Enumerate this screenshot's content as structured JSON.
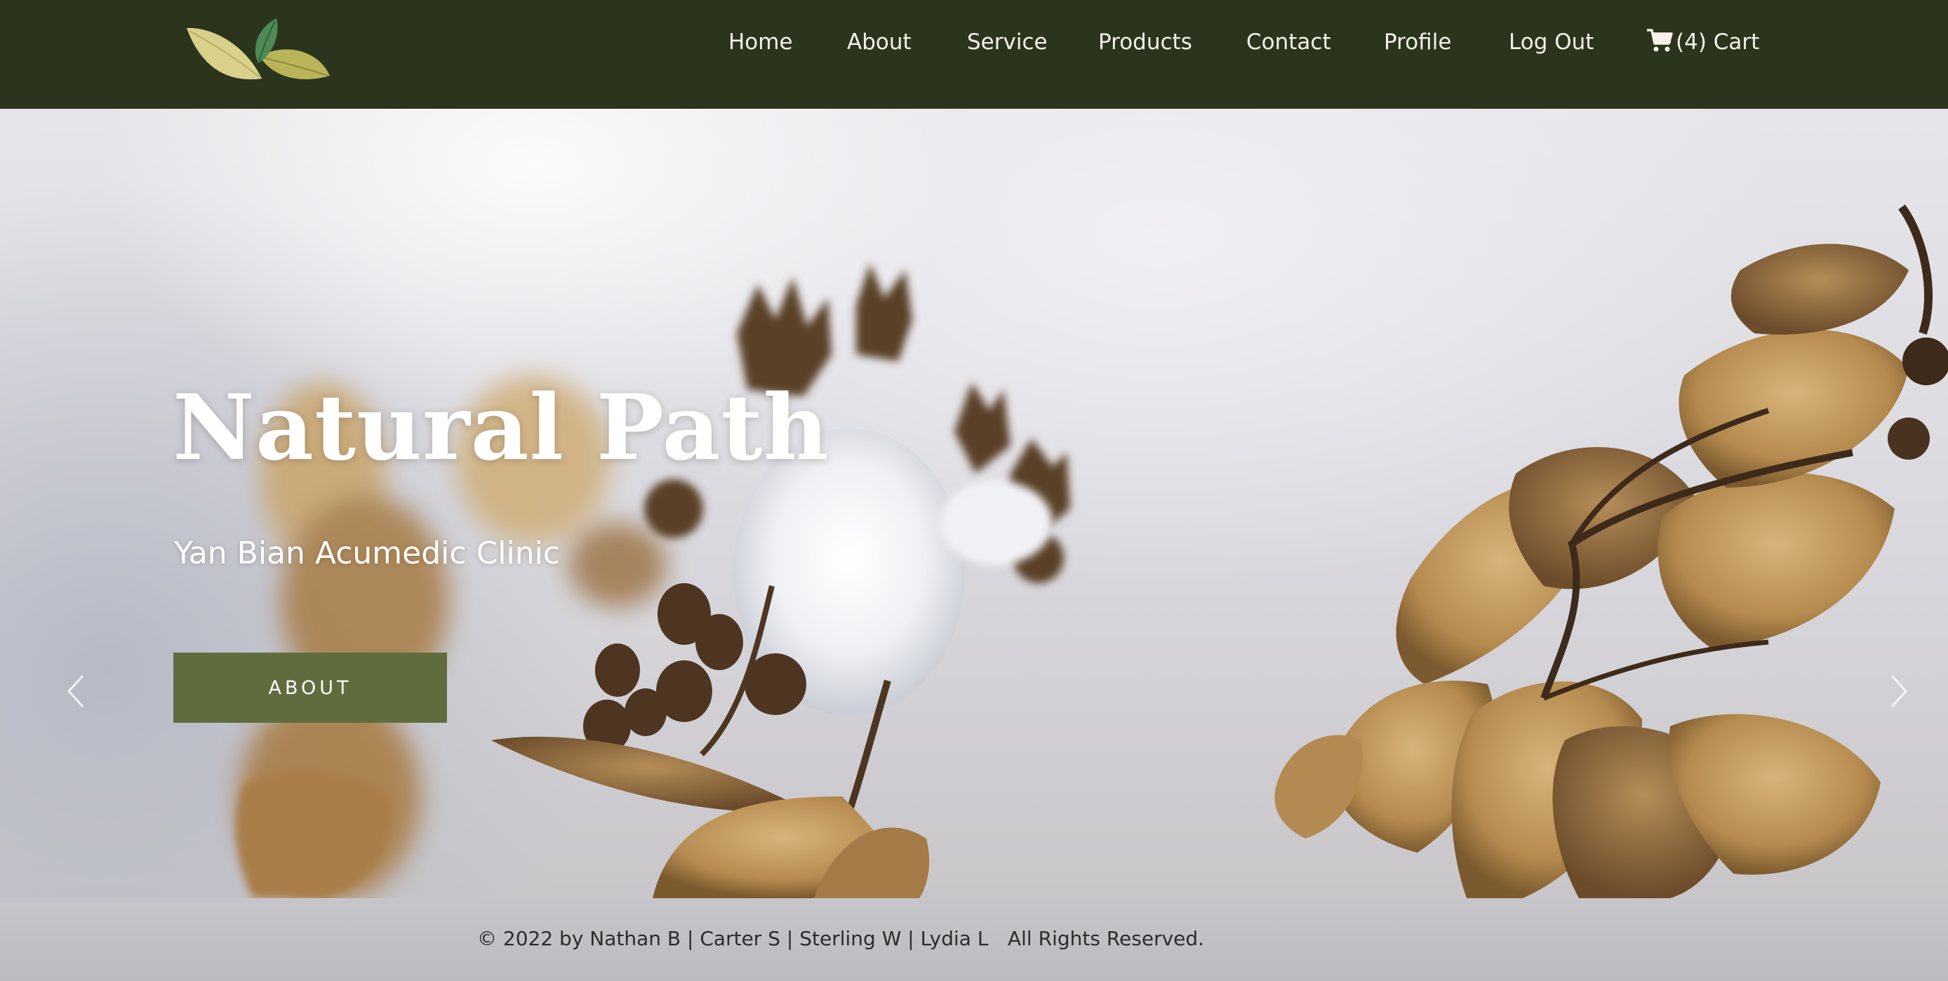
{
  "header": {
    "logo_icon": "leaves-logo-icon",
    "nav": [
      {
        "label": "Home"
      },
      {
        "label": "About"
      },
      {
        "label": "Service"
      },
      {
        "label": "Products"
      },
      {
        "label": "Contact"
      },
      {
        "label": "Profile"
      },
      {
        "label": "Log Out"
      }
    ],
    "cart": {
      "icon": "shopping-cart-icon",
      "label": "(4) Cart"
    }
  },
  "hero": {
    "title": "Natural Path",
    "subtitle": "Yan Bian Acumedic Clinic",
    "button_label": "ABOUT",
    "prev_icon": "chevron-left-icon",
    "next_icon": "chevron-right-icon"
  },
  "footer": {
    "copyright": "© 2022 by Nathan B | Carter S | Sterling W | Lydia L",
    "rights": "All Rights Reserved."
  },
  "colors": {
    "header_bg": "#2b351d",
    "button_bg": "#5f6d3e",
    "footer_bg": "#c4c3c8",
    "nav_text": "#f4f2ea"
  }
}
